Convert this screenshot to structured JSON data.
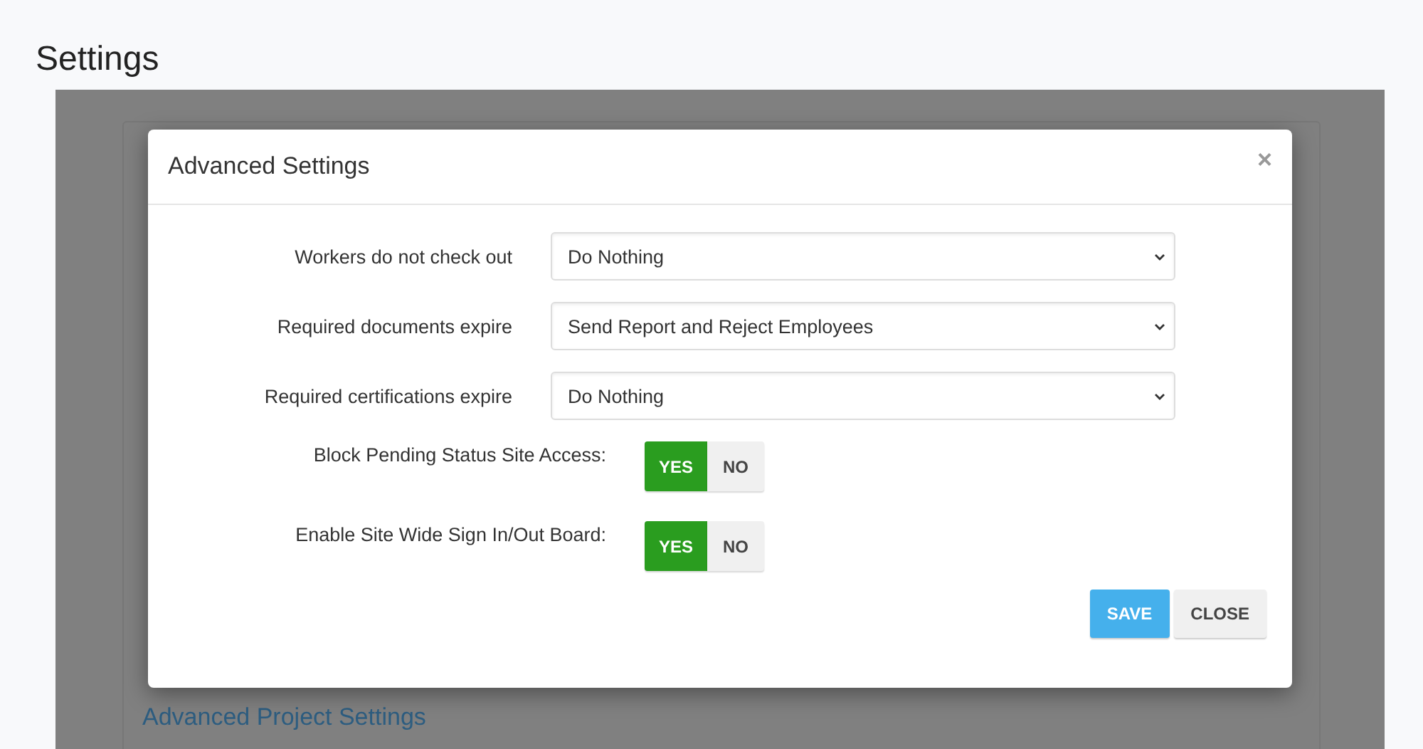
{
  "page_title": "Settings",
  "background": {
    "section_link": "Advanced Project Settings"
  },
  "modal": {
    "title": "Advanced Settings",
    "close": "×",
    "selects": [
      {
        "label": "Workers do not check out",
        "value": "Do Nothing"
      },
      {
        "label": "Required documents expire",
        "value": "Send Report and Reject Employees"
      },
      {
        "label": "Required certifications expire",
        "value": "Do Nothing"
      }
    ],
    "toggles": [
      {
        "label": "Block Pending Status Site Access:",
        "options": [
          {
            "label": "YES",
            "selected": true
          },
          {
            "label": "NO",
            "selected": false
          }
        ]
      },
      {
        "label": "Enable Site Wide Sign In/Out Board:",
        "options": [
          {
            "label": "YES",
            "selected": true
          },
          {
            "label": "NO",
            "selected": false
          }
        ]
      }
    ],
    "buttons": [
      {
        "label": "SAVE",
        "kind": "primary"
      },
      {
        "label": "CLOSE",
        "kind": "secondary"
      }
    ]
  }
}
